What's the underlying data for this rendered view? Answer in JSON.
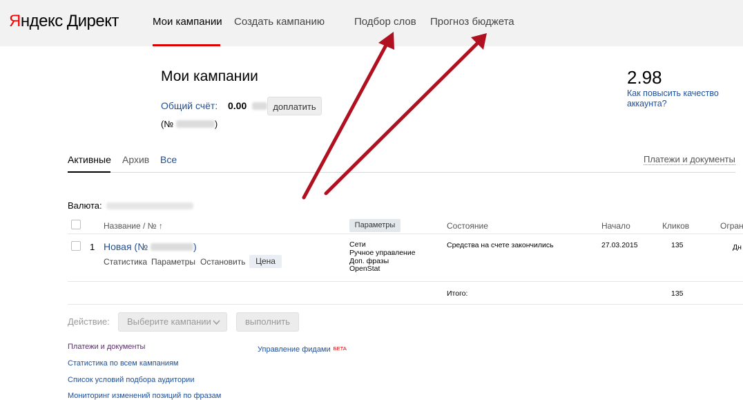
{
  "logo": {
    "ya": "Я",
    "ndex": "ндекс",
    "direct": "Директ"
  },
  "nav": {
    "my_campaigns": "Мои кампании",
    "create_campaign": "Создать кампанию",
    "word_selection": "Подбор слов",
    "budget_forecast": "Прогноз бюджета"
  },
  "page": {
    "title": "Мои кампании",
    "account_label": "Общий счёт:",
    "account_value": "0.00",
    "pay_button": "доплатить",
    "account_number_prefix": "(№",
    "account_number_suffix": ")"
  },
  "quality": {
    "score": "2.98",
    "link": "Как повысить качество аккаунта?"
  },
  "tabs": {
    "active": "Активные",
    "archive": "Архив",
    "all": "Все"
  },
  "payments_link": "Платежи и документы",
  "currency_label": "Валюта:",
  "table": {
    "headers": {
      "name": "Название / № ↑",
      "params": "Параметры",
      "status": "Состояние",
      "start": "Начало",
      "clicks": "Кликов",
      "limit": "Огран"
    },
    "rows": [
      {
        "index": "1",
        "name": "Новая (№",
        "name_suffix": ")",
        "actions": {
          "stats": "Статистика",
          "params": "Параметры",
          "stop": "Остановить",
          "price": "Цена"
        },
        "settings": [
          "Сети",
          "Ручное управление",
          "Доп. фразы",
          "OpenStat"
        ],
        "status": "Средства на счете закончились",
        "start": "27.03.2015",
        "clicks": "135",
        "limit": "Дн"
      }
    ],
    "total_label": "Итого:",
    "total_clicks": "135"
  },
  "actions": {
    "label": "Действие:",
    "select": "Выберите кампании",
    "run": "выполнить"
  },
  "footer": {
    "links_left": [
      "Платежи и документы",
      "Статистика по всем кампаниям",
      "Список условий подбора аудитории",
      "Мониторинг изменений позиций по фразам"
    ],
    "feeds": "Управление фидами",
    "beta": "БЕТА"
  },
  "colors": {
    "link": "#1d4e97",
    "accent_red": "#d00",
    "annotation_arrow": "#b01020"
  }
}
